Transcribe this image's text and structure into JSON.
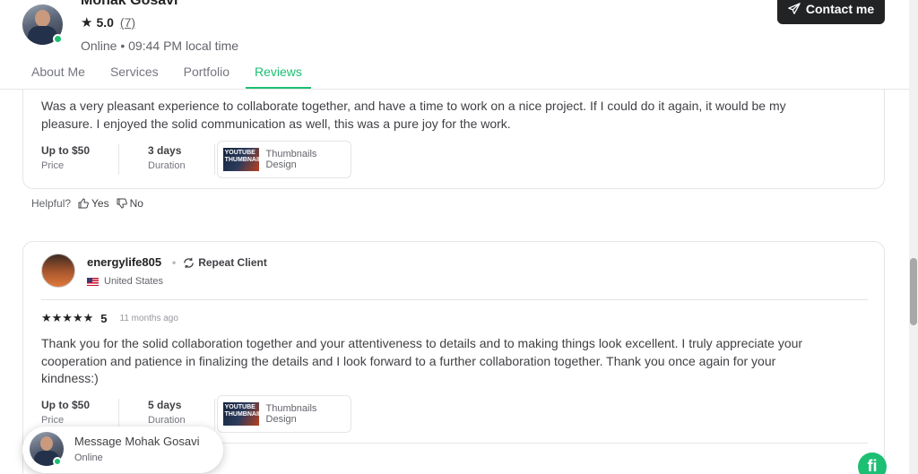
{
  "seller": {
    "name": "Mohak Gosavi",
    "rating": "5.0",
    "review_count": "(7)",
    "status": "Online • 09:44 PM local time"
  },
  "contact_label": "Contact me",
  "tabs": [
    {
      "label": "About Me"
    },
    {
      "label": "Services"
    },
    {
      "label": "Portfolio"
    },
    {
      "label": "Reviews",
      "active": true
    }
  ],
  "reviews": [
    {
      "text": "Was a very pleasant experience to collaborate together, and have a time to work on a nice project. If I could do it again, it would be my pleasure. I enjoyed the solid communication as well, this was a pure joy for the work.",
      "price_value": "Up to $50",
      "price_label": "Price",
      "duration_value": "3 days",
      "duration_label": "Duration",
      "gig_thumb_text": "YOUTUBE THUMBNAIL",
      "gig_title": "Thumbnails Design"
    },
    {
      "reviewer": "energylife805",
      "repeat_label": "Repeat Client",
      "country": "United States",
      "stars": "★★★★★",
      "score": "5",
      "time_ago": "11 months ago",
      "text": "Thank you for the solid collaboration together and your attentiveness to details and to making things look excellent. I truly appreciate your cooperation and patience in finalizing the details and I look forward to a further collaboration together. Thank you once again for your kindness:)",
      "price_value": "Up to $50",
      "price_label": "Price",
      "duration_value": "5 days",
      "duration_label": "Duration",
      "gig_thumb_text": "YOUTUBE THUMBNAIL",
      "gig_title": "Thumbnails Design"
    }
  ],
  "helpful": {
    "label": "Helpful?",
    "yes": "Yes",
    "no": "No"
  },
  "message_chip": {
    "title": "Message Mohak Gosavi",
    "status": "Online"
  },
  "logo_text": "fi",
  "colors": {
    "accent": "#1dbf73",
    "dark_button": "#222325",
    "text": "#404145"
  }
}
